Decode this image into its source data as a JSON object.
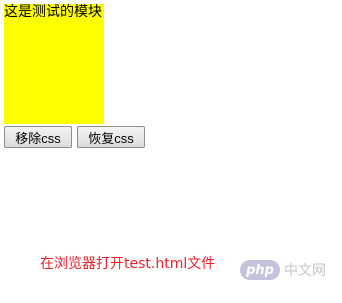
{
  "block": {
    "text": "这是测试的模块",
    "background": "#ffff00"
  },
  "buttons": {
    "remove_label": "移除css",
    "restore_label": "恢复css"
  },
  "caption": {
    "text": "在浏览器打开test.html文件",
    "color": "#e8222d"
  },
  "watermark": {
    "logo": "php",
    "site": "中文网"
  }
}
